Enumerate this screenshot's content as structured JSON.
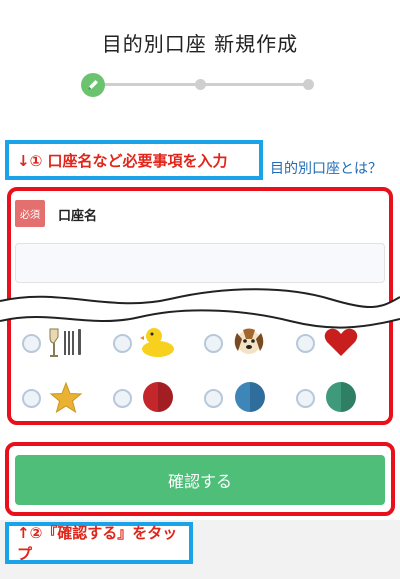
{
  "header": {
    "title": "目的別口座 新規作成"
  },
  "steps": {
    "count": 3,
    "current": 1,
    "active_icon": "pencil-icon"
  },
  "annotations": {
    "step1": "↓① 口座名など必要事項を入力",
    "step2": "↑②『確認する』をタップ"
  },
  "form": {
    "about_link": "目的別口座とは？",
    "required_badge": "必須",
    "account_name_label": "口座名",
    "account_name_value": "",
    "icon_options": [
      "wine-glasses-icon",
      "rubber-duck-icon",
      "dog-icon",
      "heart-icon",
      "star-icon",
      "red-circle-icon",
      "blue-circle-icon",
      "green-circle-icon"
    ]
  },
  "confirm_button": {
    "label": "確認する"
  },
  "colors": {
    "accent_green": "#4fbe79",
    "annotation_blue": "#1aa3e8",
    "annotation_red": "#e8101a",
    "link_blue": "#1f6bb5",
    "badge_red": "#e36f6f"
  }
}
